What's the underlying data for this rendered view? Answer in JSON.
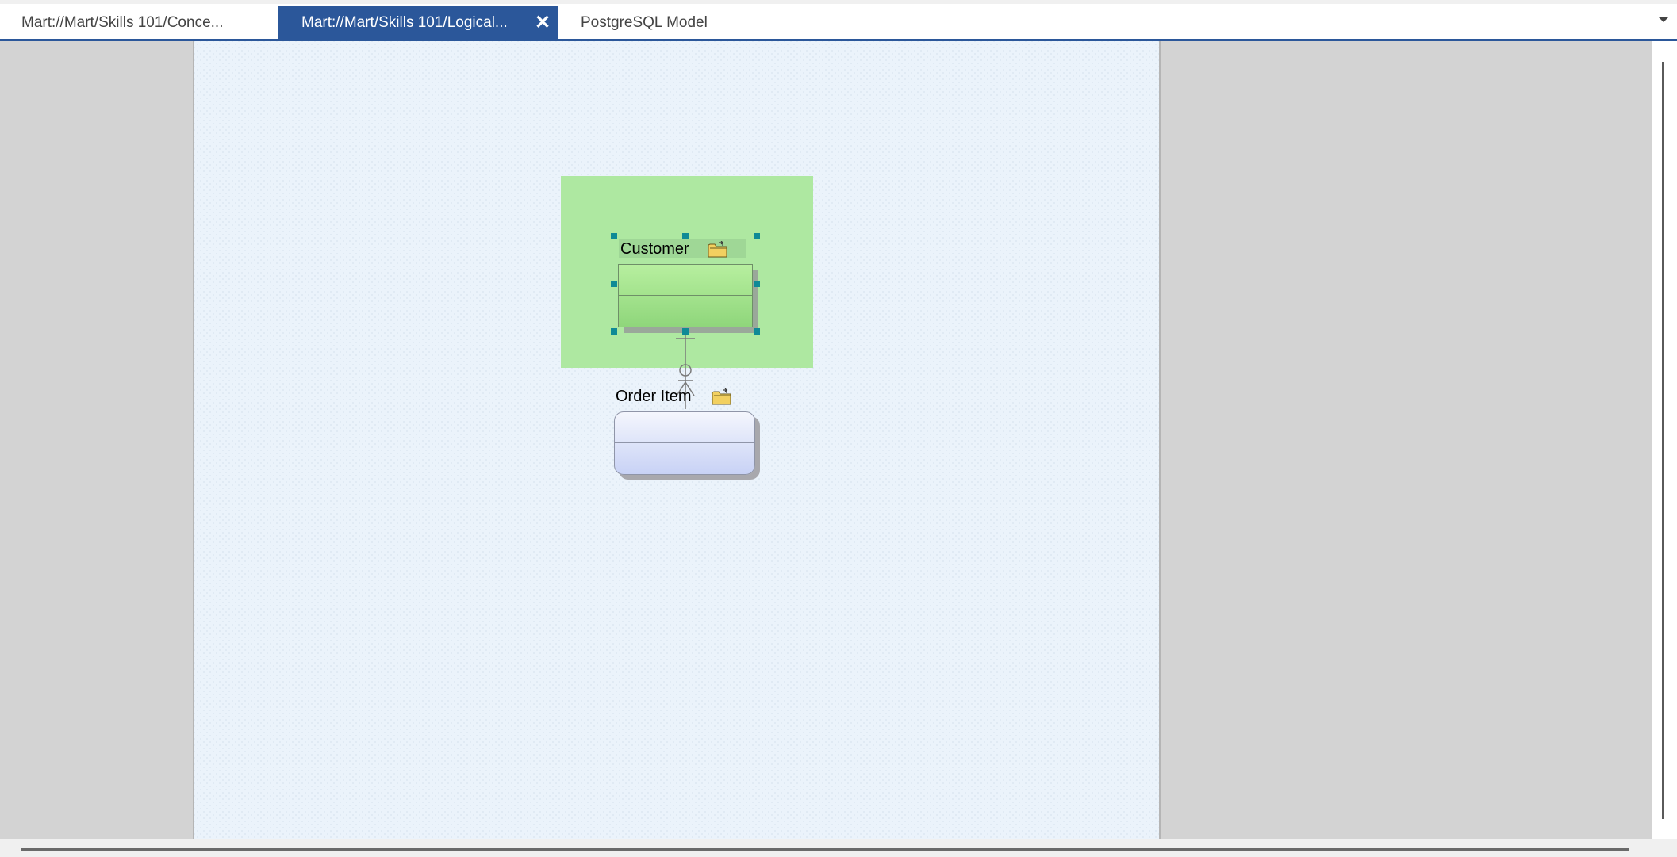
{
  "tabs": [
    {
      "label": "Mart://Mart/Skills 101/Conce...",
      "active": false
    },
    {
      "label": "Mart://Mart/Skills 101/Logical...",
      "active": true,
      "close_icon": "close-icon",
      "close_glyph": "✕"
    },
    {
      "label": "PostgreSQL Model",
      "active": false
    }
  ],
  "tabbar": {
    "overflow_icon": "chevron-down-icon"
  },
  "diagram": {
    "subject_area_color": "#aee8a1",
    "entities": [
      {
        "name": "Customer",
        "selected": true,
        "icon": "folder-icon",
        "color": "#9fd796"
      },
      {
        "name": "Order Item",
        "selected": false,
        "icon": "folder-icon",
        "color": "#c8d2f5"
      }
    ],
    "relationship": {
      "from": "Customer",
      "to": "Order Item",
      "parent_end": "one",
      "child_end": "zero-or-many"
    }
  },
  "colors": {
    "accent": "#2b579a",
    "selection_handle": "#0f8a96",
    "canvas": "#ebf3fb",
    "workspace": "#d3d3d3"
  }
}
